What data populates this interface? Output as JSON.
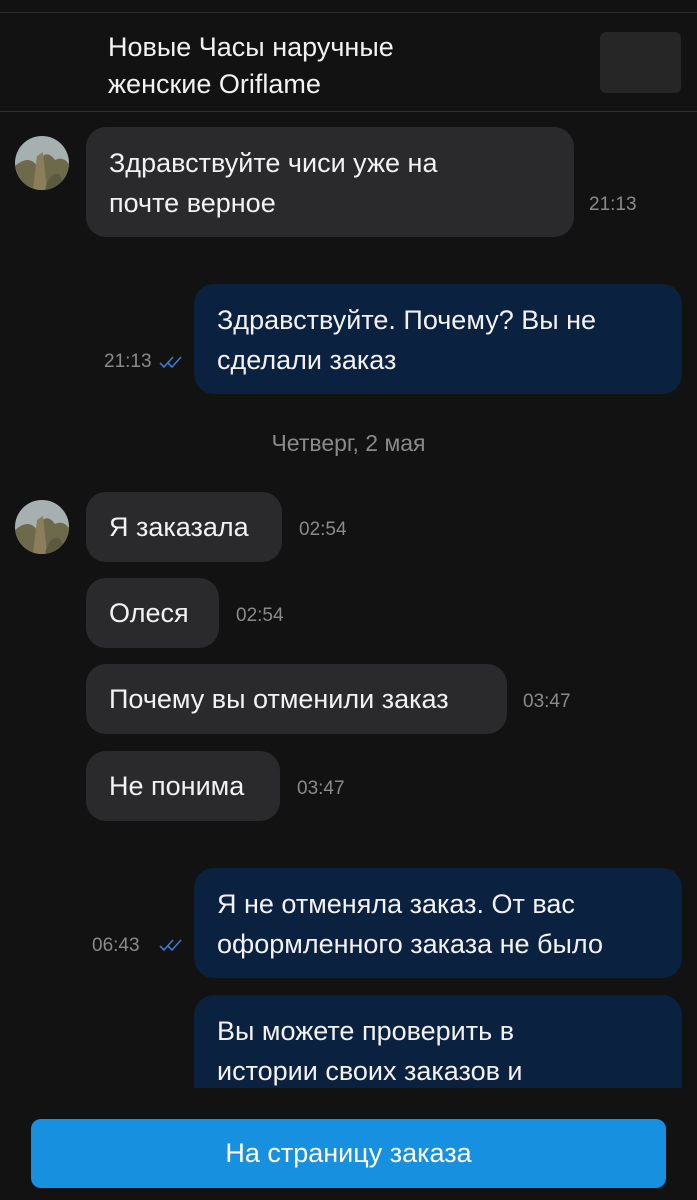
{
  "header": {
    "title_line1": "Новые Часы наручные",
    "title_line2": "женские Oriflame"
  },
  "messages": [
    {
      "side": "in",
      "line1": "Здравствуйте чиси уже на",
      "line2": "почте верное",
      "time": "21:13"
    },
    {
      "side": "out",
      "line1": "Здравствуйте. Почему? Вы не",
      "line2": "сделали заказ",
      "time": "21:13",
      "status": "read"
    },
    {
      "side": "in",
      "text": "Я заказала",
      "time": "02:54"
    },
    {
      "side": "in",
      "text": "Олеся",
      "time": "02:54"
    },
    {
      "side": "in",
      "text": "Почему вы отменили заказ",
      "time": "03:47"
    },
    {
      "side": "in",
      "text": "Не понима",
      "time": "03:47"
    },
    {
      "side": "out",
      "line1": "Я не отменяла заказ. От вас",
      "line2": "оформленного заказа не было",
      "time": "06:43",
      "status": "read"
    },
    {
      "side": "out",
      "line1": "Вы можете проверить в",
      "line2": "истории своих заказов и"
    }
  ],
  "date_separator": "Четверг, 2 мая",
  "order_button_label": "На страницу заказа",
  "colors": {
    "background": "#121212",
    "incoming_bubble": "#2a2a2c",
    "outgoing_bubble": "#0b2140",
    "accent_button": "#1890e0",
    "read_ticks": "#3a7bd5"
  }
}
